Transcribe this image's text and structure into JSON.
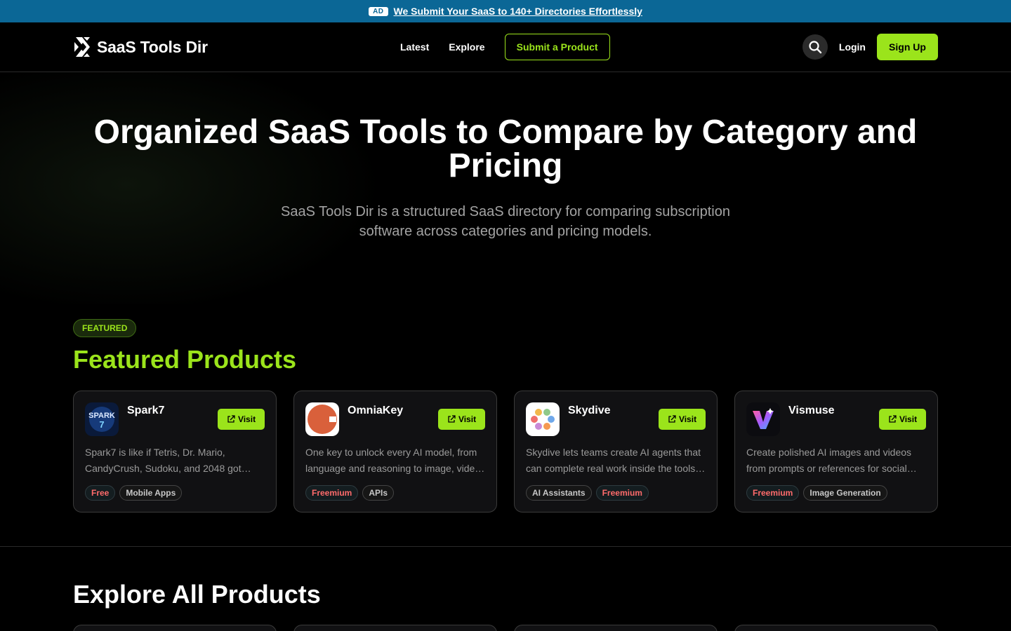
{
  "ad": {
    "badge": "AD",
    "text": "We Submit Your SaaS to 140+ Directories Effortlessly"
  },
  "header": {
    "logo_text": "SaaS Tools Dir",
    "nav": {
      "latest": "Latest",
      "explore": "Explore",
      "submit": "Submit a Product"
    },
    "login": "Login",
    "signup": "Sign Up",
    "search_icon": "search-icon"
  },
  "hero": {
    "title": "Organized SaaS Tools to Compare by Category and Pricing",
    "subtitle": "SaaS Tools Dir is a structured SaaS directory for comparing subscription software across categories and pricing models."
  },
  "featured": {
    "pill": "FEATURED",
    "title": "Featured Products",
    "visit_label": "Visit",
    "products": [
      {
        "name": "Spark7",
        "desc_line1": "Spark7 is like if Tetris, Dr. Mario,",
        "desc_line2": "CandyCrush, Sudoku, and 2048 got…",
        "tag1": "Free",
        "tag2": "Mobile Apps"
      },
      {
        "name": "OmniaKey",
        "desc_line1": "One key to unlock every AI model, from",
        "desc_line2": "language and reasoning to image, vide…",
        "tag1": "Freemium",
        "tag2": "APIs"
      },
      {
        "name": "Skydive",
        "desc_line1": "Skydive lets teams create AI agents that",
        "desc_line2": "can complete real work inside the tools…",
        "tag1": "AI Assistants",
        "tag2": "Freemium"
      },
      {
        "name": "Vismuse",
        "desc_line1": "Create polished AI images and videos",
        "desc_line2": "from prompts or references for social…",
        "tag1": "Freemium",
        "tag2": "Image Generation"
      }
    ]
  },
  "explore": {
    "title": "Explore All Products"
  },
  "colors": {
    "accent": "#9be41b",
    "ad_bar": "#0b6796",
    "price_tag": "#ff6b6b"
  }
}
